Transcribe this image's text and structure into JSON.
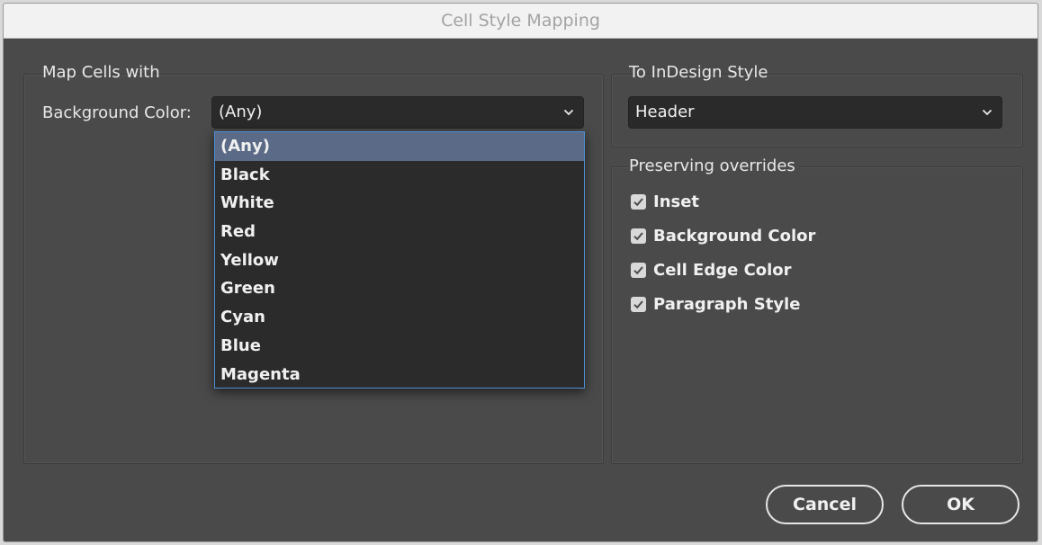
{
  "window": {
    "title": "Cell Style Mapping"
  },
  "left_group": {
    "label": "Map Cells with",
    "background_color_label": "Background Color:",
    "background_color_value": "(Any)",
    "options": [
      "(Any)",
      "Black",
      "White",
      "Red",
      "Yellow",
      "Green",
      "Cyan",
      "Blue",
      "Magenta"
    ],
    "selected_index": 0
  },
  "right_group": {
    "label": "To InDesign Style",
    "style_value": "Header"
  },
  "overrides": {
    "label": "Preserving overrides",
    "items": [
      {
        "label": "Inset",
        "checked": true
      },
      {
        "label": "Background Color",
        "checked": true
      },
      {
        "label": "Cell Edge Color",
        "checked": true
      },
      {
        "label": "Paragraph Style",
        "checked": true
      }
    ]
  },
  "buttons": {
    "cancel": "Cancel",
    "ok": "OK"
  },
  "icons": {
    "dropdown": "chevron-down-icon",
    "checkbox": "checkmark-icon"
  }
}
